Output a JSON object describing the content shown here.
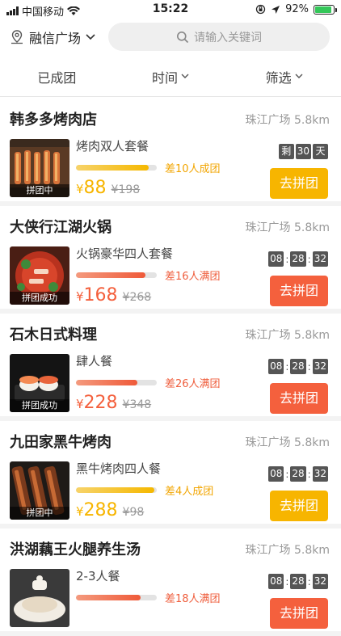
{
  "status_bar": {
    "carrier": "中国移动",
    "time": "15:22",
    "battery": "92%"
  },
  "header": {
    "location": "融信广场",
    "search_placeholder": "请输入关键词"
  },
  "filters": [
    {
      "label": "已成团",
      "has_arrow": false
    },
    {
      "label": "时间",
      "has_arrow": true
    },
    {
      "label": "筛选",
      "has_arrow": true
    }
  ],
  "colors": {
    "gold": "#f7b500",
    "orange_red": "#f4603d",
    "gold_text": "#f2a500",
    "red_text": "#ef5e3d"
  },
  "items": [
    {
      "name": "韩多多烤肉店",
      "distance": "珠江广场  5.8km",
      "status": "拼团中",
      "deal": "烤肉双人套餐",
      "progress": 0.9,
      "theme": "gold",
      "remain": "差10人成团",
      "price_symbol": "¥",
      "price": "88",
      "original": "¥198",
      "timer": {
        "mode": "days",
        "prefix": "剩",
        "value": "30",
        "suffix": "天"
      },
      "button": "去拼团"
    },
    {
      "name": "大侠行江湖火锅",
      "distance": "珠江广场  5.8km",
      "status": "拼团成功",
      "deal": "火锅豪华四人套餐",
      "progress": 0.86,
      "theme": "red",
      "remain": "差16人满团",
      "price_symbol": "¥",
      "price": "168",
      "original": "¥268",
      "timer": {
        "mode": "clock",
        "h": "08",
        "m": "28",
        "s": "32"
      },
      "button": "去拼团"
    },
    {
      "name": "石木日式料理",
      "distance": "珠江广场  5.8km",
      "status": "拼团成功",
      "deal": "肆人餐",
      "progress": 0.76,
      "theme": "red",
      "remain": "差26人满团",
      "price_symbol": "¥",
      "price": "228",
      "original": "¥348",
      "timer": {
        "mode": "clock",
        "h": "08",
        "m": "28",
        "s": "32"
      },
      "button": "去拼团"
    },
    {
      "name": "九田家黑牛烤肉",
      "distance": "珠江广场  5.8km",
      "status": "拼团中",
      "deal": "黑牛烤肉四人餐",
      "progress": 0.97,
      "theme": "gold",
      "remain": "差4人成团",
      "price_symbol": "¥",
      "price": "288",
      "original": "¥98",
      "timer": {
        "mode": "clock",
        "h": "08",
        "m": "28",
        "s": "32"
      },
      "button": "去拼团"
    },
    {
      "name": "洪湖藕王火腿养生汤",
      "distance": "珠江广场  5.8km",
      "status": "",
      "deal": "2-3人餐",
      "progress": 0.8,
      "theme": "red",
      "remain": "差18人满团",
      "price_symbol": "",
      "price": "",
      "original": "",
      "timer": {
        "mode": "clock",
        "h": "08",
        "m": "28",
        "s": "32"
      },
      "button": "去拼团"
    }
  ]
}
